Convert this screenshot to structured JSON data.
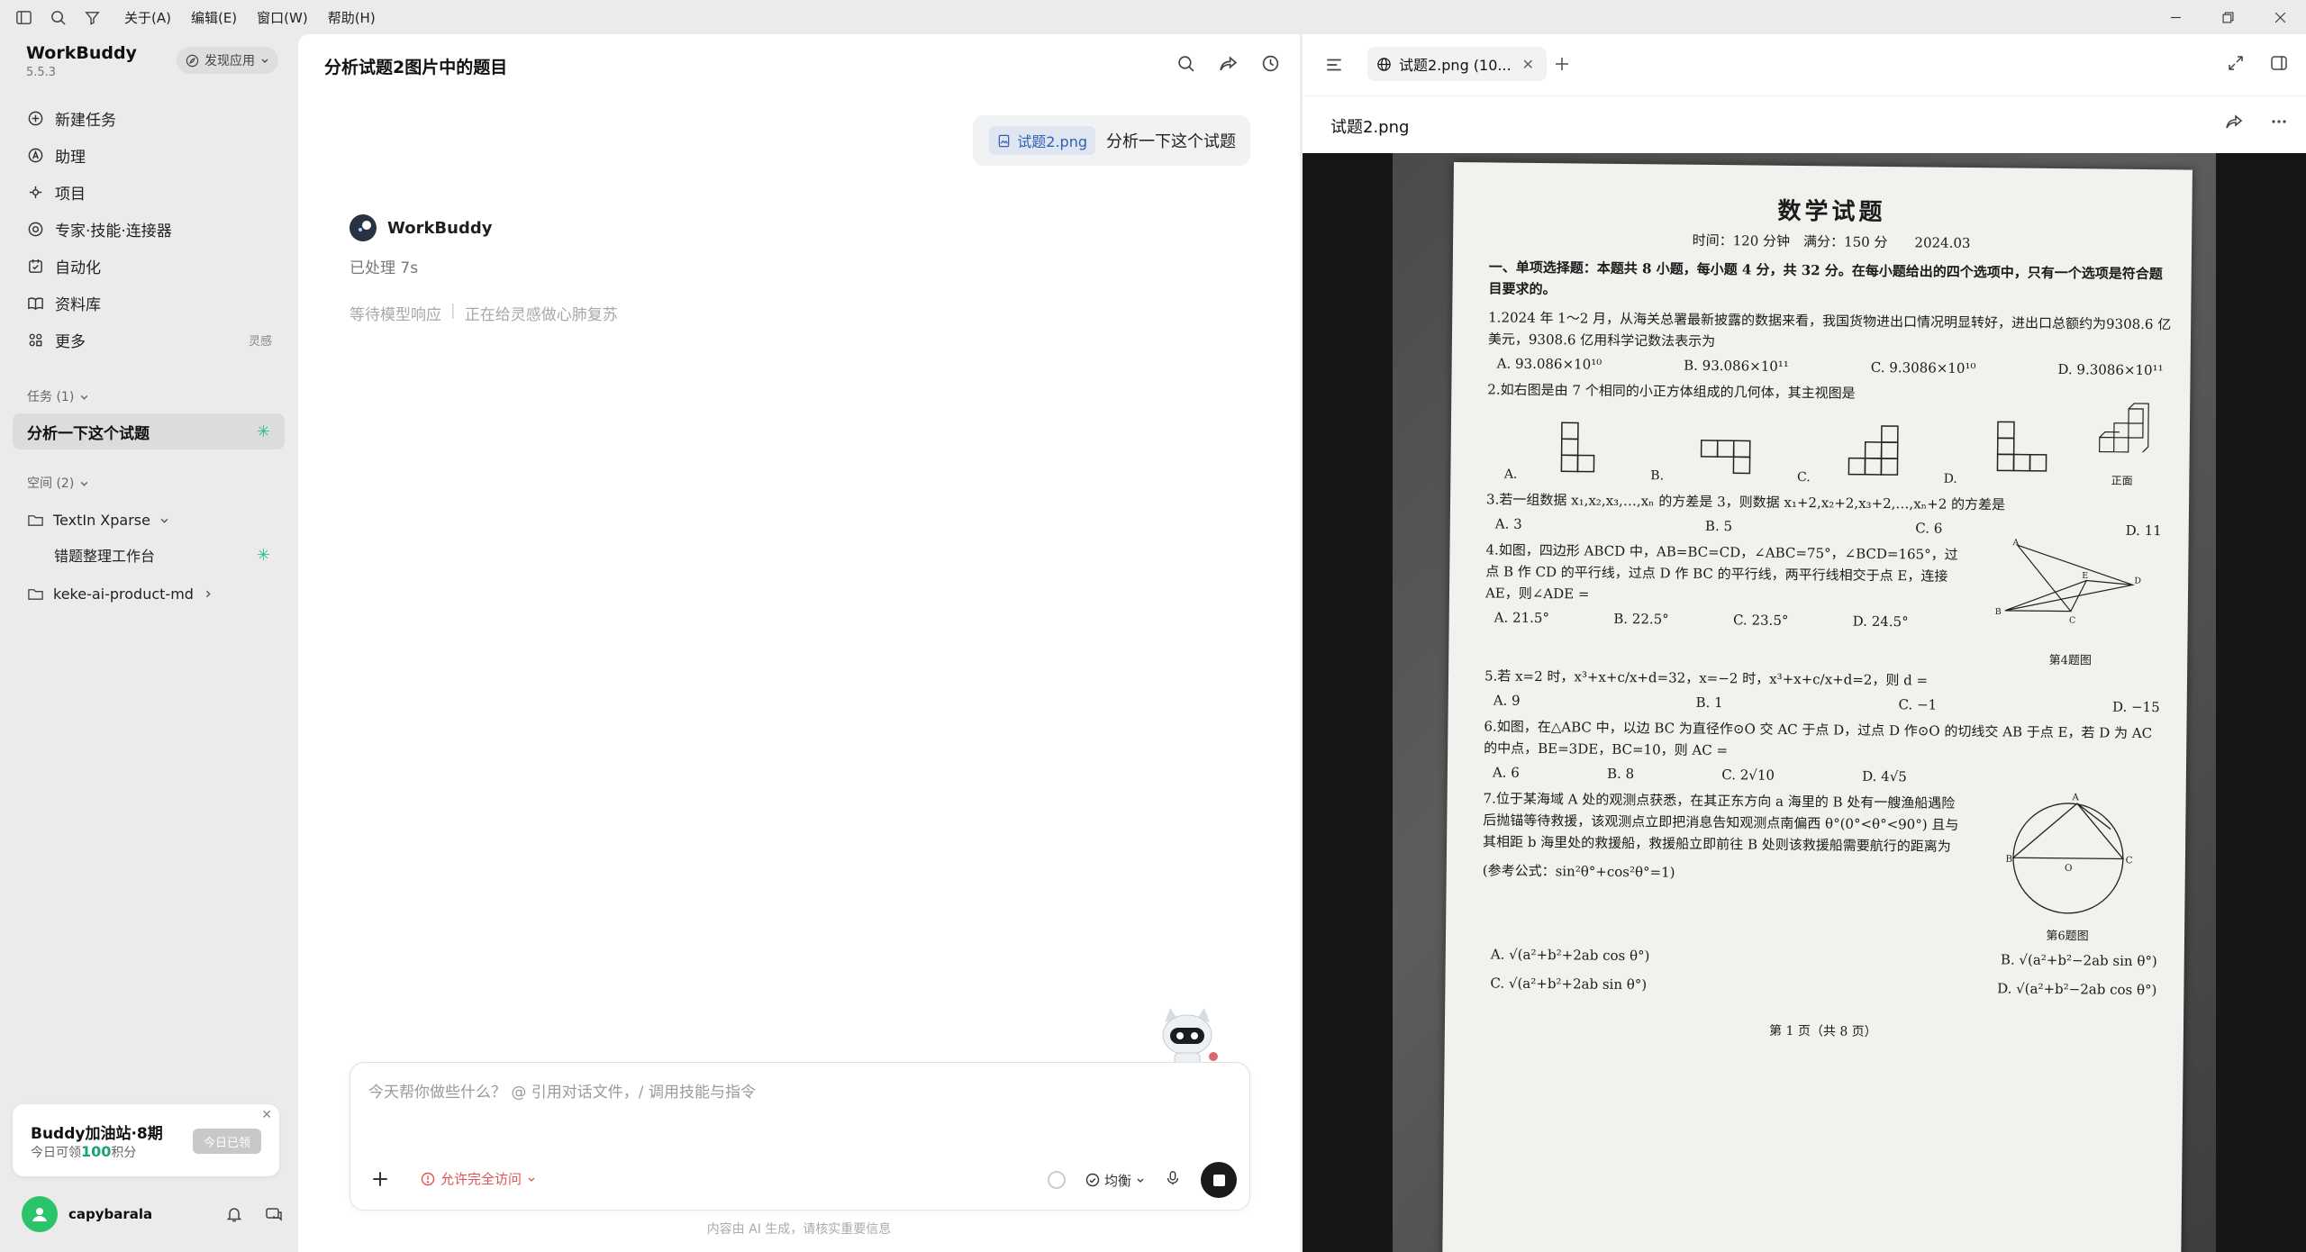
{
  "menubar": {
    "items": [
      "关于(A)",
      "编辑(E)",
      "窗口(W)",
      "帮助(H)"
    ]
  },
  "sidebar": {
    "app_name": "WorkBuddy",
    "version": "5.5.3",
    "discover_label": "发现应用",
    "nav": [
      {
        "label": "新建任务",
        "icon": "new-task-icon"
      },
      {
        "label": "助理",
        "icon": "assistant-icon"
      },
      {
        "label": "项目",
        "icon": "project-icon"
      },
      {
        "label": "专家·技能·连接器",
        "icon": "expert-icon"
      },
      {
        "label": "自动化",
        "icon": "automation-icon"
      },
      {
        "label": "资料库",
        "icon": "library-icon"
      },
      {
        "label": "更多",
        "icon": "more-icon",
        "tag": "灵感"
      }
    ],
    "tasks_title": "任务 (1)",
    "task_item": "分析一下这个试题",
    "spaces_title": "空间 (2)",
    "spaces": [
      {
        "label": "TextIn Xparse",
        "expanded": true
      },
      {
        "label": "错题整理工作台",
        "child": true
      },
      {
        "label": "keke-ai-product-md",
        "expanded": false
      }
    ],
    "promo": {
      "title": "Buddy加油站·8期",
      "sub_prefix": "今日可领",
      "sub_points": "100",
      "sub_suffix": "积分",
      "button": "今日已领"
    },
    "user": {
      "name": "capybarala"
    }
  },
  "chat": {
    "title": "分析试题2图片中的题目",
    "user_message": {
      "file": "试题2.png",
      "text": "分析一下这个试题"
    },
    "bot_name": "WorkBuddy",
    "processed": "已处理 7s",
    "status_waiting": "等待模型响应",
    "status_separator": "|",
    "status_thinking": "正在给灵感做心肺复苏",
    "input_placeholder": "今天帮你做些什么？ @ 引用对话文件，/ 调用技能与指令",
    "access_label": "允许完全访问",
    "mode_label": "均衡",
    "disclaimer": "内容由 AI 生成，请核实重要信息"
  },
  "preview": {
    "tab_label": "试题2.png (10...",
    "file_name": "试题2.png",
    "exam": {
      "title": "数学试题",
      "meta": "时间：120 分钟　满分：150 分　　2024.03",
      "section1": "一、单项选择题：本题共 8 小题，每小题 4 分，共 32 分。在每小题给出的四个选项中，只有一个选项是符合题目要求的。",
      "q1": "1.2024 年 1～2 月，从海关总署最新披露的数据来看，我国货物进出口情况明显转好，进出口总额约为9308.6 亿美元，9308.6 亿用科学记数法表示为",
      "q1_opts": [
        "A. 93.086×10¹⁰",
        "B. 93.086×10¹¹",
        "C. 9.3086×10¹⁰",
        "D. 9.3086×10¹¹"
      ],
      "q2": "2.如右图是由 7 个相同的小正方体组成的几何体，其主视图是",
      "q2_opts": [
        "A.",
        "B.",
        "C.",
        "D."
      ],
      "q2_front": "正面",
      "q3": "3.若一组数据 x₁,x₂,x₃,…,xₙ 的方差是 3，则数据 x₁+2,x₂+2,x₃+2,…,xₙ+2 的方差是",
      "q3_opts": [
        "A. 3",
        "B. 5",
        "C. 6",
        "D. 11"
      ],
      "q4": "4.如图，四边形 ABCD 中，AB=BC=CD，∠ABC=75°，∠BCD=165°，过点 B 作 CD 的平行线，过点 D 作 BC 的平行线，两平行线相交于点 E，连接 AE，则∠ADE =",
      "q4_opts": [
        "A. 21.5°",
        "B. 22.5°",
        "C. 23.5°",
        "D. 24.5°"
      ],
      "q4_fig": "第4题图",
      "q5": "5.若 x=2 时，x³+x+c/x+d=32，x=−2 时，x³+x+c/x+d=2，则 d =",
      "q5_opts": [
        "A. 9",
        "B. 1",
        "C. −1",
        "D. −15"
      ],
      "q6": "6.如图，在△ABC 中，以边 BC 为直径作⊙O 交 AC 于点 D，过点 D 作⊙O 的切线交 AB 于点 E，若 D 为 AC 的中点，BE=3DE，BC=10，则 AC =",
      "q6_opts": [
        "A. 6",
        "B. 8",
        "C. 2√10",
        "D. 4√5"
      ],
      "q6_fig": "第6题图",
      "q7": "7.位于某海域 A 处的观测点获悉，在其正东方向 a 海里的 B 处有一艘渔船遇险后抛锚等待救援，该观测点立即把消息告知观测点南偏西 θ°(0°<θ°<90°) 且与其相距 b 海里处的救援船，救援船立即前往 B 处则该救援船需要航行的距离为",
      "q7_ref": "(参考公式：sin²θ°+cos²θ°=1)",
      "q7_opts": [
        "A. √(a²+b²+2ab cos θ°)",
        "B. √(a²+b²−2ab sin θ°)",
        "C. √(a²+b²+2ab sin θ°)",
        "D. √(a²+b²−2ab cos θ°)"
      ],
      "footer": "第 1 页（共 8 页）"
    }
  }
}
